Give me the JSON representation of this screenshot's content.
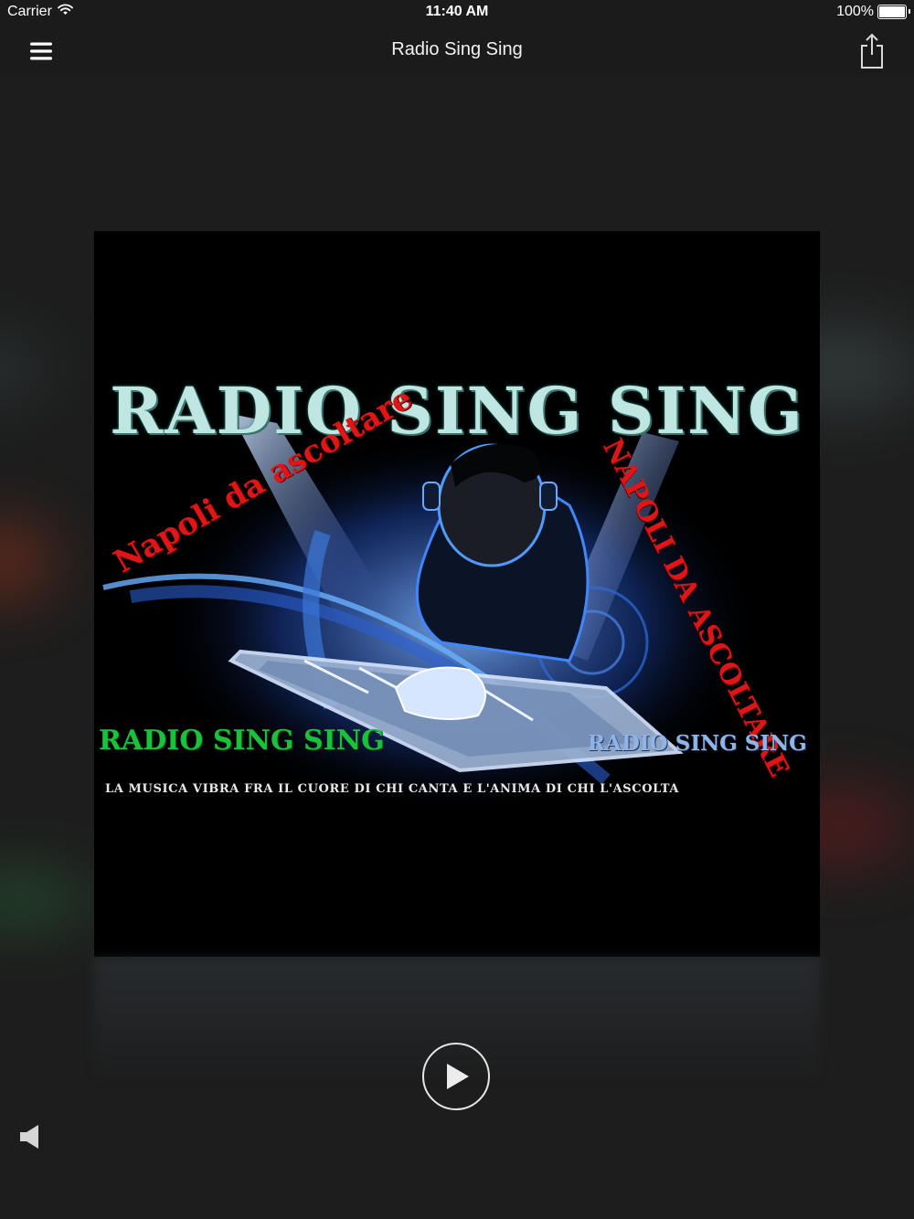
{
  "status_bar": {
    "carrier": "Carrier",
    "time": "11:40 AM",
    "battery": "100%",
    "battery_level": 1.0
  },
  "nav": {
    "title": "Radio Sing Sing",
    "menu_icon": "hamburger-icon",
    "share_icon": "share-icon"
  },
  "artwork": {
    "main_title": "RADIO SING SING",
    "left_slogan": "Napoli da ascoltare",
    "right_slogan": "NAPOLI DA ASCOLTARE",
    "green_label": "RADIO SING SING",
    "blue_label": "RADIO SING SING",
    "tagline": "LA MUSICA VIBRA FRA IL CUORE DI CHI CANTA E L'ANIMA DI CHI L'ASCOLTA"
  },
  "player": {
    "play_icon": "play-icon",
    "volume_icon": "speaker-icon"
  },
  "colors": {
    "background": "#1c1c1c",
    "bar": "#1b1b1b",
    "title_teal": "#bfe6e0",
    "slogan_red": "#e01515",
    "label_green": "#19c23a",
    "label_blue": "#8fb4ea"
  }
}
